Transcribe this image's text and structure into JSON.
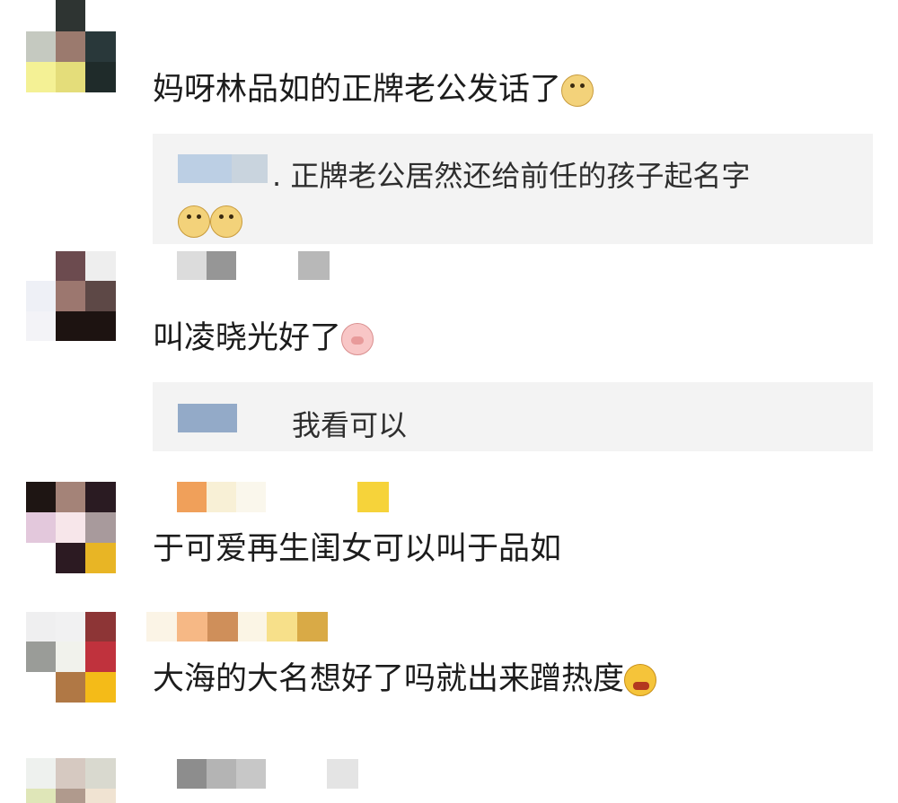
{
  "comments": [
    {
      "text": "妈呀林品如的正牌老公发话了",
      "emoji": "doge-icon",
      "reply": {
        "text": ". 正牌老公居然还给前任的孩子起名字",
        "emojis": [
          "doge-icon",
          "doge-icon"
        ]
      }
    },
    {
      "text": "叫凌晓光好了",
      "emoji": "pig-icon",
      "reply": {
        "text": "我看可以"
      }
    },
    {
      "text": "于可爱再生闺女可以叫于品如"
    },
    {
      "text": "大海的大名想好了吗就出来蹭热度",
      "emoji": "angry-icon"
    }
  ]
}
